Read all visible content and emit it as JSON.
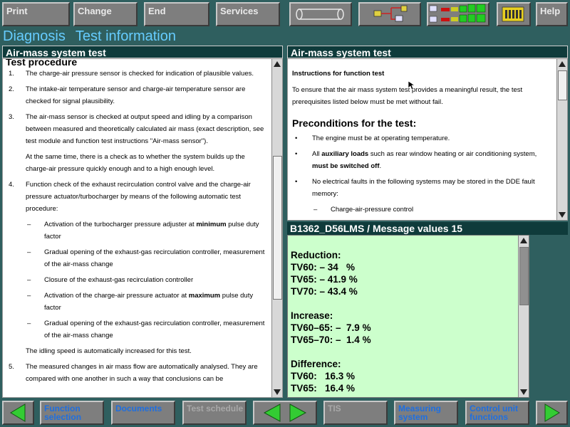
{
  "toolbar": {
    "print": "Print",
    "change": "Change",
    "end": "End",
    "services": "Services",
    "help": "Help"
  },
  "heading": {
    "part1": "Diagnosis",
    "part2": "Test information"
  },
  "left_panel": {
    "title": "Air-mass system test",
    "section": "Test procedure",
    "item1_num": "1.",
    "item1": "The charge-air pressure sensor is checked for indication of plausible values.",
    "item2_num": "2.",
    "item2": "The intake-air temperature sensor and charge-air temperature sensor are checked for signal plausibility.",
    "item3_num": "3.",
    "item3": "The air-mass sensor is checked at output speed and idling by a comparison between measured and theoretically calculated air mass (exact description, see test module and function test instructions \"Air-mass sensor\").",
    "item3_para": "At the same time, there is a check as to whether the system builds up the charge-air pressure quickly enough and to a high enough level.",
    "item4_num": "4.",
    "item4": "Function check of the exhaust recirculation control valve and the charge-air pressure actuator/turbocharger by means of the following automatic test procedure:",
    "dash": "–",
    "sub1a": "Activation of the turbocharger pressure adjuster at ",
    "sub1b": "minimum",
    "sub1c": " pulse duty factor",
    "sub2": "Gradual opening of the exhaust-gas recirculation controller, measurement of the air-mass change",
    "sub3": "Closure of the exhaust-gas recirculation controller",
    "sub4a": "Activation of the charge-air pressure actuator at ",
    "sub4b": "maximum",
    "sub4c": " pulse duty factor",
    "sub5": "Gradual opening of the exhaust-gas recirculation controller, measurement of the air-mass change",
    "item4_para": "The idling speed is automatically increased for this test.",
    "item5_num": "5.",
    "item5": "The measured changes in air mass flow are automatically analysed. They are compared with one another in such a way that conclusions can be"
  },
  "right_panel": {
    "title": "Air-mass system test",
    "instructions_heading": "Instructions for function test",
    "instructions": "To ensure that the air mass system test provides a meaningful result, the test prerequisites listed below must be met without fail.",
    "preconditions_heading": "Preconditions for the test:",
    "pre1": "The engine must be at operating temperature.",
    "pre2a": "All ",
    "pre2b": "auxiliary loads",
    "pre2c": " such as rear window heating or air conditioning system, ",
    "pre2d": "must be switched off",
    "pre2e": ".",
    "pre3": "No electrical faults in the following systems may be stored in the DDE fault memory:",
    "pre3_sub": "Charge-air-pressure control",
    "bullet": "•",
    "dash": "–"
  },
  "message_panel": {
    "title": "B1362_D56LMS / Message values 15",
    "reduction_heading": "Reduction:",
    "reduction_tv60": "TV60: – 34   %",
    "reduction_tv65": "TV65: – 41.9 %",
    "reduction_tv70": "TV70: – 43.4 %",
    "increase_heading": "Increase:",
    "increase_tv60_65": "TV60–65: –  7.9 %",
    "increase_tv65_70": "TV65–70: –  1.4 %",
    "difference_heading": "Difference:",
    "difference_tv60": "TV60:   16.3 %",
    "difference_tv65": "TV65:   16.4 %"
  },
  "bottom_bar": {
    "function_selection": "Function selection",
    "documents": "Documents",
    "test_schedule": "Test schedule",
    "tis": "TIS",
    "measuring_system": "Measuring system",
    "control_unit_functions": "Control unit functions"
  },
  "colors": {
    "background": "#2f5f5f",
    "heading": "#66ccff",
    "panel_title_bg": "#0f3b3b",
    "message_bg": "#ccffcc",
    "nav_arrow": "#33cc33",
    "link_text": "#1f6fe0"
  }
}
